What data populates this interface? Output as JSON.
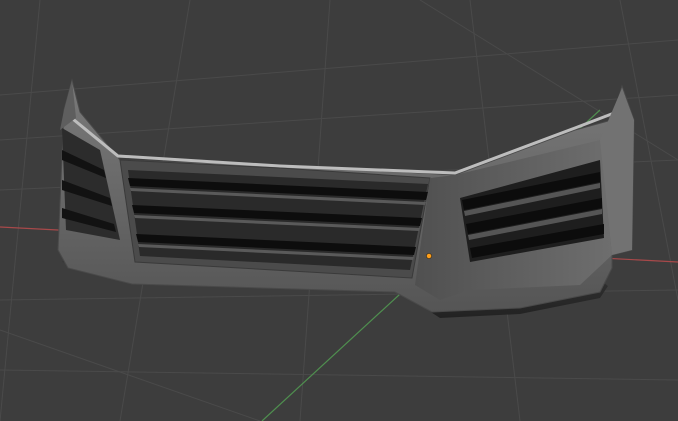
{
  "viewport": {
    "background": "#3d3d3d",
    "grid_color": "#4a4a4a",
    "x_axis_color": "#a8494a",
    "y_axis_color": "#4f8f4f",
    "origin_marker_color": "#ff9f1a"
  },
  "object": {
    "icon": "front-bumper-mesh",
    "body_color": "#6a6a6a",
    "highlight_color": "#bdbdbd",
    "slat_color": "#141414",
    "lower_lip_color": "#2e2e2e"
  }
}
